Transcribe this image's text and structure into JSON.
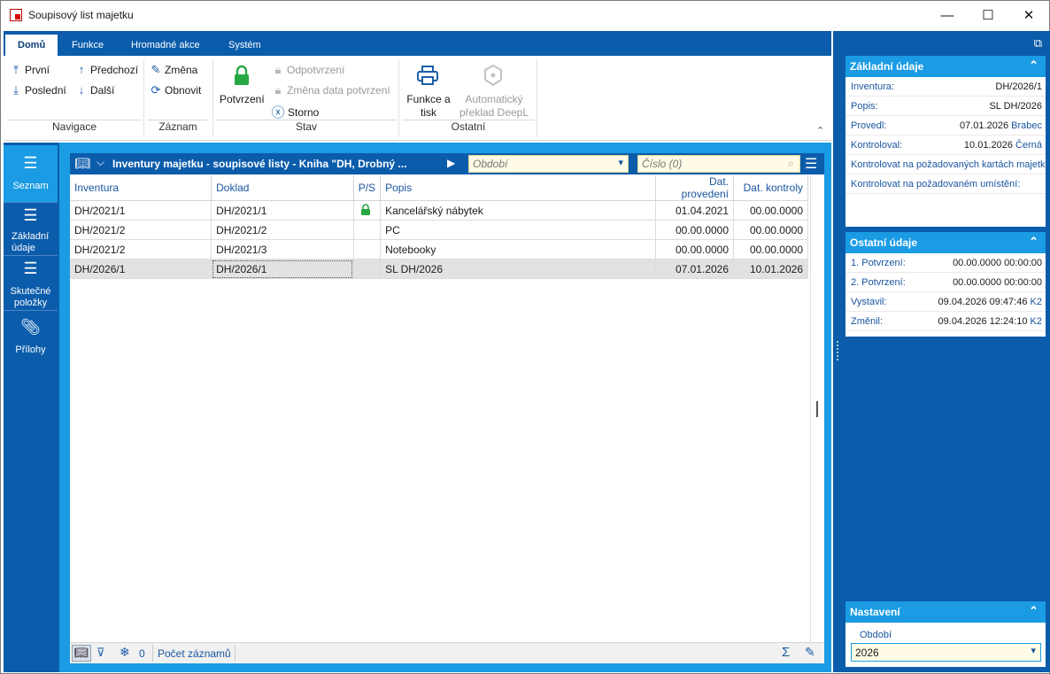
{
  "window": {
    "title": "Soupisový list majetku",
    "minimize": "—",
    "maximize": "☐",
    "close": "✕"
  },
  "tabs": [
    {
      "label": "Domů",
      "active": true
    },
    {
      "label": "Funkce"
    },
    {
      "label": "Hromadné akce"
    },
    {
      "label": "Systém"
    }
  ],
  "ribbon": {
    "navigace": {
      "first": "První",
      "prev": "Předchozí",
      "last": "Poslední",
      "next": "Další",
      "label": "Navigace"
    },
    "zaznam": {
      "change": "Změna",
      "refresh": "Obnovit",
      "label": "Záznam"
    },
    "stav": {
      "confirm": "Potvrzení",
      "unconfirm": "Odpotvrzení",
      "change_date": "Změna data potvrzení",
      "cancel": "Storno",
      "label": "Stav"
    },
    "ostatni": {
      "print": "Funkce a tisk",
      "translate": "Automatický překlad DeepL",
      "label": "Ostatní"
    }
  },
  "nav": [
    {
      "label": "Seznam",
      "active": true
    },
    {
      "label": "Základní údaje"
    },
    {
      "label": "Skutečné položky"
    },
    {
      "label": "Přílohy"
    }
  ],
  "grid": {
    "title": "Inventury majetku - soupisové listy - Kniha \"DH, Drobný ...",
    "period_placeholder": "Období",
    "number_placeholder": "Číslo (0)",
    "columns": [
      "Inventura",
      "Doklad",
      "P/S",
      "Popis",
      "Dat. provedení",
      "Dat. kontroly"
    ],
    "rows": [
      {
        "inventura": "DH/2021/1",
        "doklad": "DH/2021/1",
        "locked": true,
        "popis": "Kancelářský nábytek",
        "dat_provedeni": "01.04.2021",
        "dat_kontroly": "00.00.0000"
      },
      {
        "inventura": "DH/2021/2",
        "doklad": "DH/2021/2",
        "locked": false,
        "popis": "PC",
        "dat_provedeni": "00.00.0000",
        "dat_kontroly": "00.00.0000"
      },
      {
        "inventura": "DH/2021/2",
        "doklad": "DH/2021/3",
        "locked": false,
        "popis": "Notebooky",
        "dat_provedeni": "00.00.0000",
        "dat_kontroly": "00.00.0000"
      },
      {
        "inventura": "DH/2026/1",
        "doklad": "DH/2026/1",
        "locked": false,
        "popis": "SL DH/2026",
        "dat_provedeni": "07.01.2026",
        "dat_kontroly": "10.01.2026",
        "selected": true
      }
    ],
    "status": {
      "count": "0",
      "records": "Počet záznamů"
    }
  },
  "zakladni": {
    "title": "Základní údaje",
    "inventura": {
      "label": "Inventura:",
      "value": "DH/2026/1"
    },
    "popis": {
      "label": "Popis:",
      "value": "SL DH/2026"
    },
    "provedl": {
      "label": "Provedl:",
      "date": "07.01.2026",
      "user": "Brabec"
    },
    "kontroloval": {
      "label": "Kontroloval:",
      "date": "10.01.2026",
      "user": "Černá"
    },
    "link1": "Kontrolovat na požadovaných kartách majetku",
    "link2": "Kontrolovat na požadovaném umístění:"
  },
  "ostatni": {
    "title": "Ostatní údaje",
    "p1": {
      "label": "1. Potvrzení:",
      "value": "00.00.0000 00:00:00"
    },
    "p2": {
      "label": "2. Potvrzení:",
      "value": "00.00.0000 00:00:00"
    },
    "vystavil": {
      "label": "Vystavil:",
      "value": "09.04.2026 09:47:46",
      "user": "K2"
    },
    "zmenil": {
      "label": "Změnil:",
      "value": "09.04.2026 12:24:10",
      "user": "K2"
    }
  },
  "nastaveni": {
    "title": "Nastavení",
    "obdobi_label": "Období",
    "obdobi_value": "2026"
  }
}
